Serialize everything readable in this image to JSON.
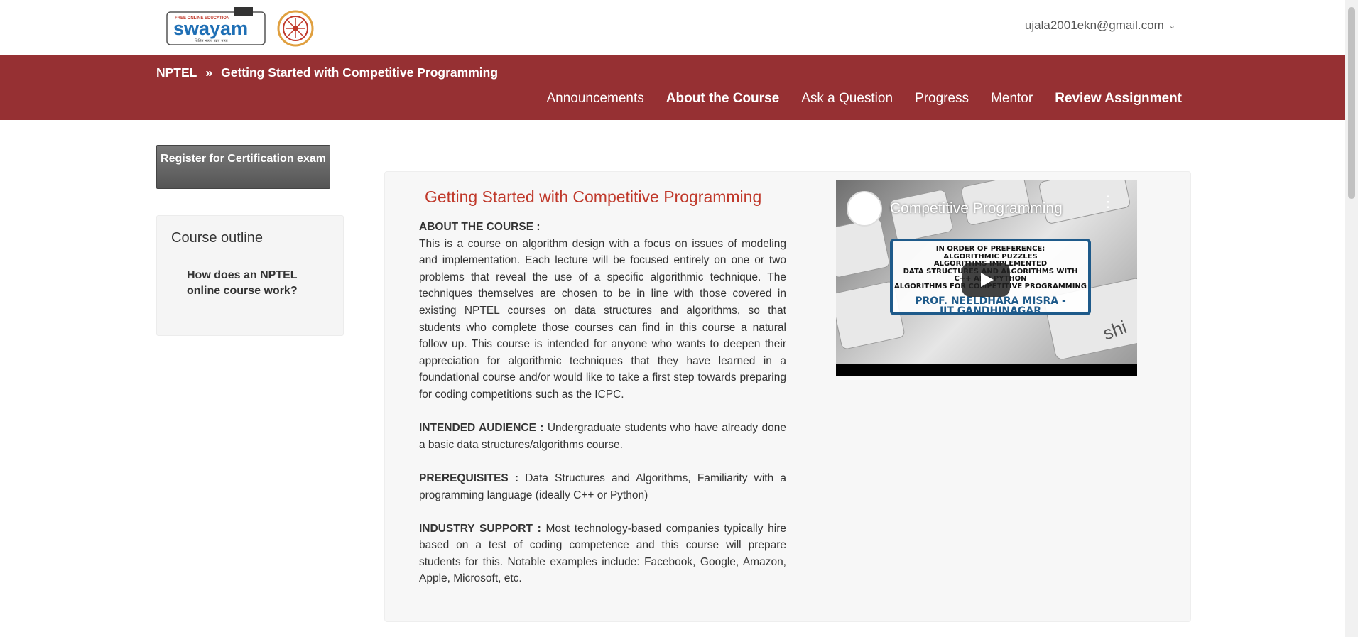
{
  "header": {
    "user_email": "ujala2001ekn@gmail.com",
    "logo_swayam_text": "swayam",
    "logo_swayam_tag": "FREE ONLINE EDUCATION",
    "logo_swayam_sub": "शिक्षित भारत, उन्नत भारत"
  },
  "breadcrumb": {
    "root": "NPTEL",
    "separator": "»",
    "current": "Getting Started with Competitive Programming"
  },
  "nav": {
    "items": [
      {
        "label": "Announcements"
      },
      {
        "label": "About the Course"
      },
      {
        "label": "Ask a Question"
      },
      {
        "label": "Progress"
      },
      {
        "label": "Mentor"
      },
      {
        "label": "Review Assignment"
      }
    ]
  },
  "sidebar": {
    "register_label": "Register for Certification exam",
    "outline_title": "Course outline",
    "outline_items": [
      {
        "label": "How does an NPTEL online course work?"
      }
    ]
  },
  "course": {
    "title": "Getting Started with Competitive Programming",
    "about_label": "ABOUT THE COURSE :",
    "about_text": "This is a course on algorithm design with a focus on issues of modeling and implementation. Each lecture will be focused entirely on one or two problems that reveal the use of a specific algorithmic technique. The techniques themselves are chosen to be in line with those covered in existing NPTEL courses on data structures and algorithms, so that students who complete those courses can find in this course a natural follow up. This course is intended for anyone who wants to deepen their appreciation for algorithmic techniques that they have learned in a foundational course and/or would like to take a first step towards preparing for coding competitions such as the ICPC.",
    "audience_label": "INTENDED AUDIENCE  :",
    "audience_text": "Undergraduate students who have already done a basic data structures/algorithms course.",
    "prereq_label": "PREREQUISITES  :",
    "prereq_text": "Data Structures and Algorithms, Familiarity with a programming language (ideally C++ or Python)",
    "industry_label": "INDUSTRY SUPPORT  :",
    "industry_text": "Most technology-based companies typically hire based on a test of coding competence and this course will prepare students for this. Notable examples include: Facebook, Google, Amazon, Apple, Microsoft, etc."
  },
  "video": {
    "title": "Competitive Programming",
    "panel_lines": [
      "IN ORDER OF PREFERENCE:",
      "ALGORITHMIC PUZZLES",
      "ALGORITHMS IMPLEMENTED",
      "DATA STRUCTURES AND ALGORITHMS WITH",
      "C++ AND PYTHON",
      "ALGORITHMS FOR COMPETITIVE PROGRAMMING"
    ],
    "presenter": "PROF. NEELDHARA MISRA -",
    "institute": "IIT GANDHINAGAR"
  },
  "colors": {
    "brand_red": "#963033",
    "title_red": "#c0392b",
    "video_border_blue": "#1e5a8a"
  }
}
